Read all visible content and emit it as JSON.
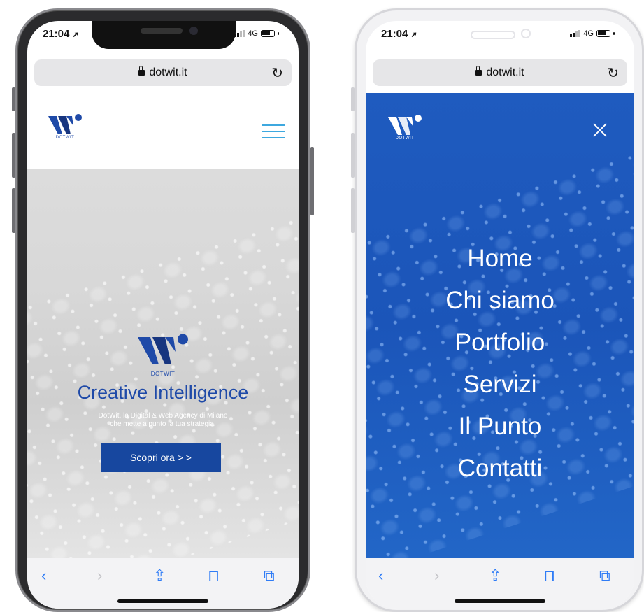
{
  "status": {
    "time": "21:04",
    "network": "4G"
  },
  "browser": {
    "url": "dotwit.it"
  },
  "site": {
    "logo_text": "DOTWIT",
    "hero": {
      "title": "Creative Intelligence",
      "subtitle_line1": "DotWit, la Digital & Web Agency di Milano",
      "subtitle_line2": "che mette a punto la tua strategia.",
      "cta": "Scopri ora > >"
    }
  },
  "menu": {
    "items": [
      "Home",
      "Chi siamo",
      "Portfolio",
      "Servizi",
      "Il Punto",
      "Contatti"
    ]
  },
  "colors": {
    "brand_blue": "#1f4aa8",
    "menu_blue": "#1f5bbf",
    "hamburger": "#3ea8df",
    "toolbar_icons": "#2f7cf6"
  }
}
